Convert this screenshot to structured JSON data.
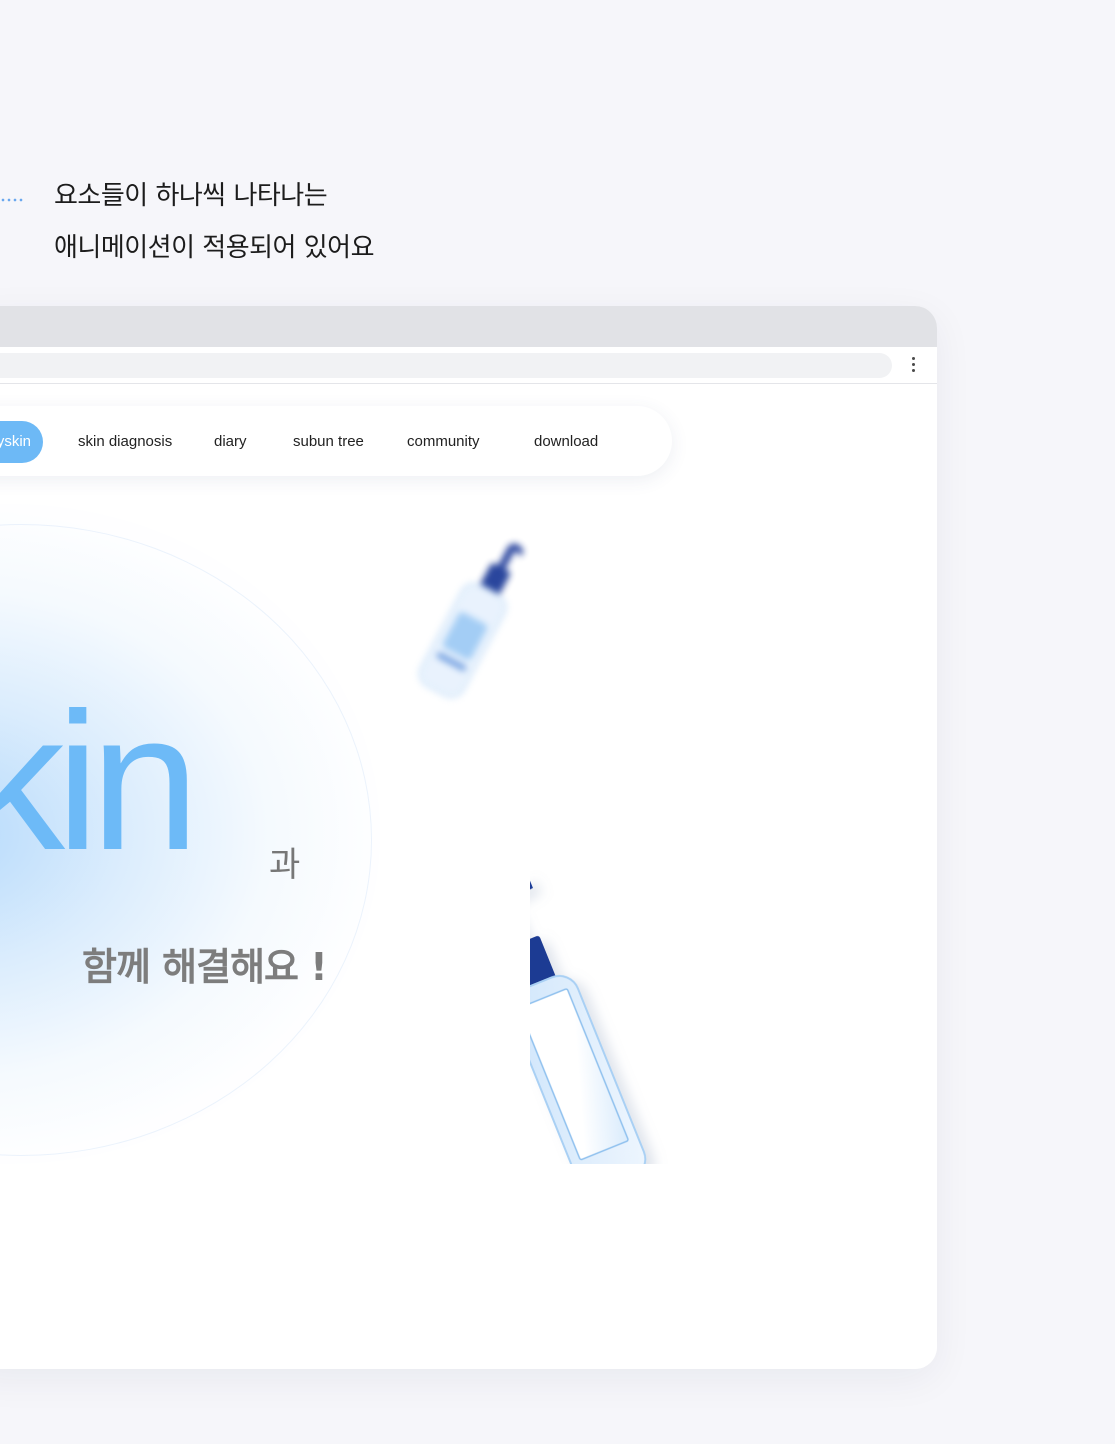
{
  "caption": {
    "line1": "요소들이 하나씩 나타나는",
    "line2": "애니메이션이 적용되어 있어요"
  },
  "browser": {
    "menu_icon": "more-vert-icon"
  },
  "nav": {
    "items": [
      {
        "label": "h dayskin",
        "active": true
      },
      {
        "label": "skin diagnosis",
        "active": false
      },
      {
        "label": "diary",
        "active": false
      },
      {
        "label": "subun tree",
        "active": false
      },
      {
        "label": "community",
        "active": false
      },
      {
        "label": "download",
        "active": false
      }
    ]
  },
  "hero": {
    "word": "skin",
    "suffix": "과",
    "subtitle": "함께 해결해요 !"
  },
  "colors": {
    "accent": "#6db9f6",
    "page_background": "#f6f6fa",
    "bottle_cap": "#1d3e9a",
    "bottle_body": "#e3f0fd"
  }
}
